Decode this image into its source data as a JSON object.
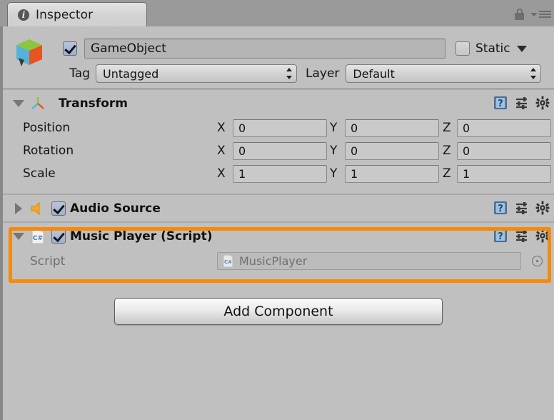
{
  "window": {
    "tab_label": "Inspector",
    "tab_icon": "info-icon",
    "lock_icon": "lock-icon",
    "menu_icon": "hamburger-menu-icon"
  },
  "object_header": {
    "icon": "gameobject-cube-icon",
    "enabled_checkbox": "checked",
    "name_value": "GameObject",
    "static_label": "Static",
    "static_checkbox": "unchecked",
    "static_dropdown_icon": "chevron-down-icon",
    "tag_label": "Tag",
    "tag_value": "Untagged",
    "layer_label": "Layer",
    "layer_value": "Default"
  },
  "components": [
    {
      "name": "Transform",
      "icon": "transform-axis-icon",
      "expanded": true,
      "foldout_icon": "triangle-down-icon",
      "help_icon": "help-book-icon",
      "preset_icon": "preset-sliders-icon",
      "gear_icon": "gear-icon",
      "rows": [
        {
          "label": "Position",
          "x": "0",
          "y": "0",
          "z": "0"
        },
        {
          "label": "Rotation",
          "x": "0",
          "y": "0",
          "z": "0"
        },
        {
          "label": "Scale",
          "x": "1",
          "y": "1",
          "z": "1"
        }
      ],
      "axis_labels": [
        "X",
        "Y",
        "Z"
      ]
    },
    {
      "name": "Audio Source",
      "icon": "audio-speaker-icon",
      "expanded": false,
      "foldout_icon": "triangle-right-icon",
      "enabled_checkbox": "checked",
      "help_icon": "help-book-icon",
      "preset_icon": "preset-sliders-icon",
      "gear_icon": "gear-icon"
    },
    {
      "name": "Music Player (Script)",
      "icon": "csharp-script-icon",
      "expanded": true,
      "foldout_icon": "triangle-down-icon",
      "enabled_checkbox": "checked",
      "help_icon": "help-book-icon",
      "preset_icon": "preset-sliders-icon",
      "gear_icon": "gear-icon",
      "highlighted": true,
      "script_field": {
        "label": "Script",
        "value": "MusicPlayer",
        "value_icon": "csharp-script-icon",
        "picker_icon": "object-picker-icon"
      }
    }
  ],
  "add_component_button": "Add Component",
  "colors": {
    "highlight": "#f58a0b",
    "panel_background": "#c0c0c0",
    "chrome_background": "#9a9a9a",
    "checkbox_blue": "#9fb0cc",
    "audio_icon_orange": "#f5a623"
  }
}
